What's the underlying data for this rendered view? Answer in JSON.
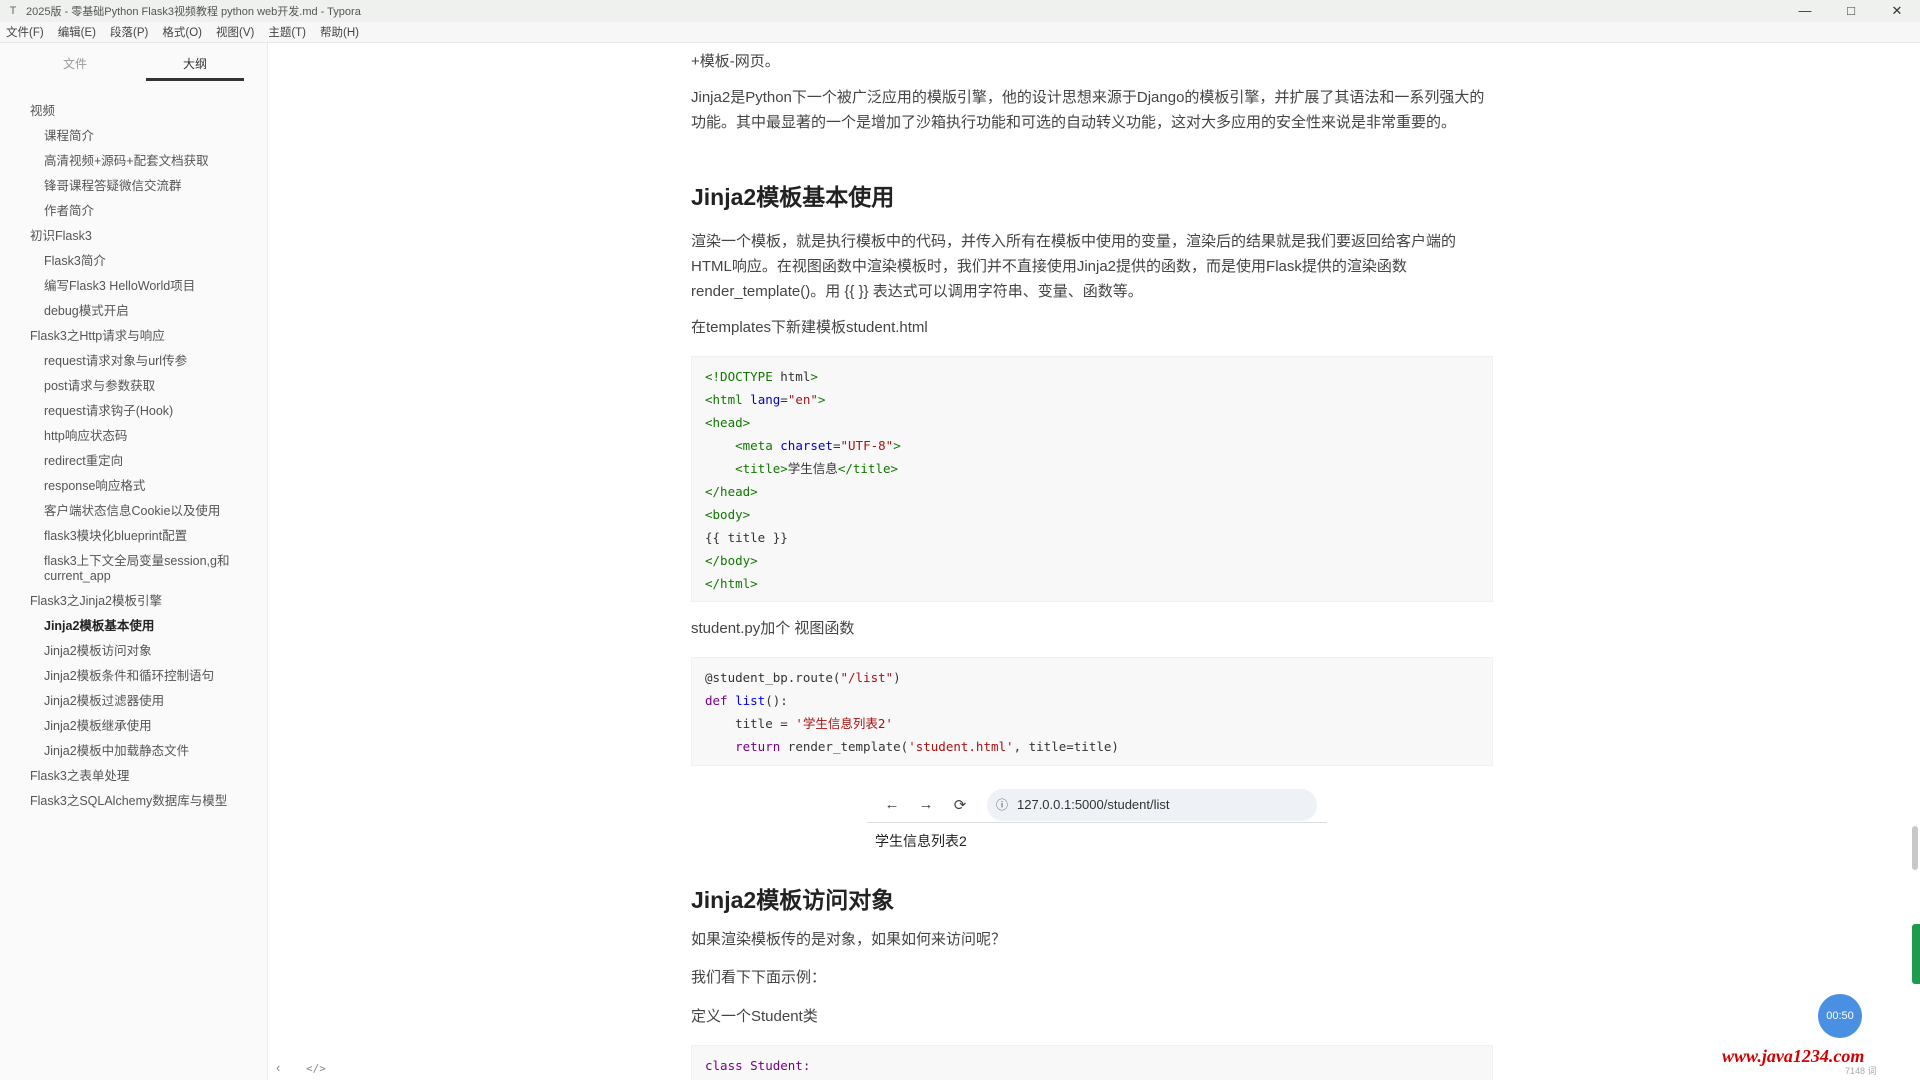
{
  "window": {
    "title": "2025版 - 零基础Python Flask3视频教程 python web开发.md - Typora",
    "controls": {
      "minimize": "—",
      "maximize": "□",
      "close": "✕"
    }
  },
  "menu": [
    "文件(F)",
    "编辑(E)",
    "段落(P)",
    "格式(O)",
    "视图(V)",
    "主题(T)",
    "帮助(H)"
  ],
  "sidebar": {
    "tabs": [
      {
        "label": "文件",
        "active": false
      },
      {
        "label": "大纲",
        "active": true
      }
    ],
    "outline": [
      {
        "text": "视频",
        "level": 1
      },
      {
        "text": "课程简介",
        "level": 2
      },
      {
        "text": "高清视频+源码+配套文档获取",
        "level": 2
      },
      {
        "text": "锋哥课程答疑微信交流群",
        "level": 2
      },
      {
        "text": "作者简介",
        "level": 2
      },
      {
        "text": "初识Flask3",
        "level": 1
      },
      {
        "text": "Flask3简介",
        "level": 2
      },
      {
        "text": "编写Flask3 HelloWorld项目",
        "level": 2
      },
      {
        "text": "debug模式开启",
        "level": 2
      },
      {
        "text": "Flask3之Http请求与响应",
        "level": 1
      },
      {
        "text": "request请求对象与url传参",
        "level": 2
      },
      {
        "text": "post请求与参数获取",
        "level": 2
      },
      {
        "text": "request请求钩子(Hook)",
        "level": 2
      },
      {
        "text": "http响应状态码",
        "level": 2
      },
      {
        "text": "redirect重定向",
        "level": 2
      },
      {
        "text": "response响应格式",
        "level": 2
      },
      {
        "text": "客户端状态信息Cookie以及使用",
        "level": 2
      },
      {
        "text": "flask3模块化blueprint配置",
        "level": 2
      },
      {
        "text": "flask3上下文全局变量session,g和current_app",
        "level": 2
      },
      {
        "text": "Flask3之Jinja2模板引擎",
        "level": 1
      },
      {
        "text": "Jinja2模板基本使用",
        "level": 2,
        "active": true
      },
      {
        "text": "Jinja2模板访问对象",
        "level": 2
      },
      {
        "text": "Jinja2模板条件和循环控制语句",
        "level": 2
      },
      {
        "text": "Jinja2模板过滤器使用",
        "level": 2
      },
      {
        "text": "Jinja2模板继承使用",
        "level": 2
      },
      {
        "text": "Jinja2模板中加载静态文件",
        "level": 2
      },
      {
        "text": "Flask3之表单处理",
        "level": 1
      },
      {
        "text": "Flask3之SQLAlchemy数据库与模型",
        "level": 1
      }
    ],
    "footer": {
      "collapse": "‹",
      "source": "</>"
    }
  },
  "doc": {
    "top_line": "+模板-网页。",
    "intro": "Jinja2是Python下一个被广泛应用的模版引擎，他的设计思想来源于Django的模板引擎，并扩展了其语法和一系列强大的功能。其中最显著的一个是增加了沙箱执行功能和可选的自动转义功能，这对大多应用的安全性来说是非常重要的。",
    "h2_basic": "Jinja2模板基本使用",
    "render_desc": "渲染一个模板，就是执行模板中的代码，并传入所有在模板中使用的变量，渲染后的结果就是我们要返回给客户端的HTML响应。在视图函数中渲染模板时，我们并不直接使用Jinja2提供的函数，而是使用Flask提供的渲染函数render_template()。用 {{ }} 表达式可以调用字符串、变量、函数等。",
    "new_file": "在templates下新建模板student.html",
    "html_code": [
      "<!DOCTYPE html>",
      "<html lang=\"en\">",
      "<head>",
      "    <meta charset=\"UTF-8\">",
      "    <title>学生信息</title>",
      "</head>",
      "<body>",
      "{{ title }}",
      "</body>",
      "</html>"
    ],
    "student_py": "student.py加个 视图函数",
    "py_code": [
      "@student_bp.route(\"/list\")",
      "def list():",
      "    title = '学生信息列表2'",
      "    return render_template('student.html', title=title)"
    ],
    "browser": {
      "back": "←",
      "forward": "→",
      "reload": "⟳",
      "url": "127.0.0.1:5000/student/list",
      "page_text": "学生信息列表2"
    },
    "h2_access": "Jinja2模板访问对象",
    "q1": "如果渲染模板传的是对象，如果如何来访问呢？",
    "q2": "我们看下下面示例：",
    "q3": "定义一个Student类",
    "class_code": "class Student:"
  },
  "timer": "00:50",
  "watermark": "www.java1234.com",
  "wordcount": "7148 词"
}
